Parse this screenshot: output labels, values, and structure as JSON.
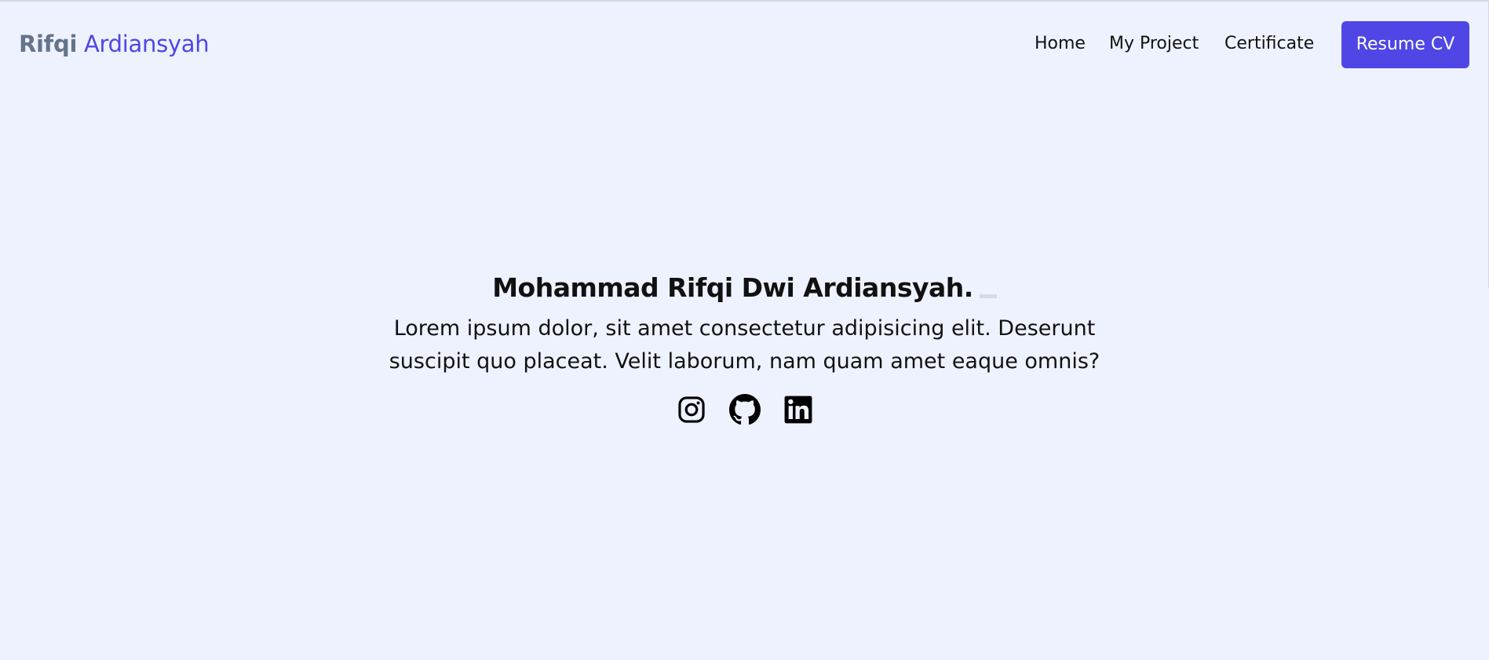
{
  "brand": {
    "first": "Rifqi",
    "last": "Ardiansyah"
  },
  "nav": {
    "links": [
      "Home",
      "My Project",
      "Certificate"
    ],
    "cta": "Resume CV"
  },
  "hero": {
    "title": "Mohammad Rifqi Dwi Ardiansyah.",
    "description": "Lorem ipsum dolor, sit amet consectetur adipisicing elit. Deserunt suscipit quo placeat. Velit laborum, nam quam amet eaque omnis?"
  },
  "socials": [
    {
      "icon": "instagram-icon"
    },
    {
      "icon": "github-icon"
    },
    {
      "icon": "linkedin-icon"
    }
  ],
  "colors": {
    "background": "#eef2fe",
    "accent": "#4f46e5",
    "brand_first": "#64748b",
    "text": "#111111"
  }
}
